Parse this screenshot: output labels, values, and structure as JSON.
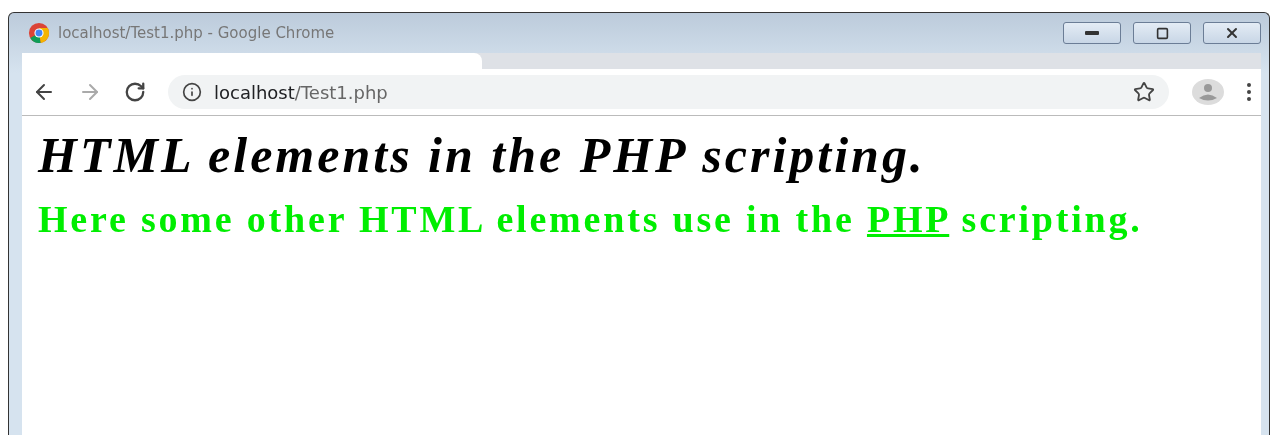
{
  "window": {
    "title": "localhost/Test1.php - Google Chrome"
  },
  "address_bar": {
    "host": "localhost",
    "path": "/Test1.php"
  },
  "page": {
    "heading": "HTML elements in the PHP scripting.",
    "paragraph": {
      "before": "Here some other HTML elements use in the ",
      "link": "PHP",
      "after": " scripting."
    }
  }
}
